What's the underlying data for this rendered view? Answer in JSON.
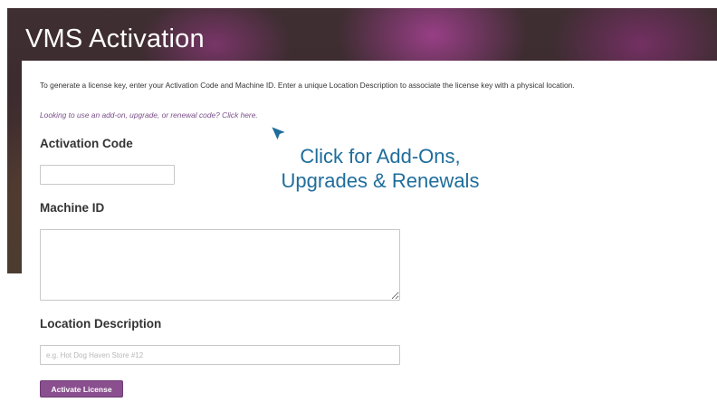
{
  "header": {
    "title": "VMS Activation"
  },
  "form": {
    "intro_text": "To generate a license key, enter your Activation Code and Machine ID. Enter a unique Location Description to associate the license key with a physical location.",
    "addon_link": "Looking to use an add-on, upgrade, or renewal code? Click here.",
    "activation_code": {
      "label": "Activation Code",
      "value": ""
    },
    "machine_id": {
      "label": "Machine ID",
      "value": ""
    },
    "location_description": {
      "label": "Location Description",
      "value": "",
      "placeholder": "e.g. Hot Dog Haven Store #12"
    },
    "activate_button": "Activate License"
  },
  "callout": {
    "line1": "Click for Add-Ons,",
    "line2": "Upgrades & Renewals",
    "icon": "mouse-pointer-icon"
  },
  "colors": {
    "button": "#8a4f8e",
    "link": "#7a4f8a",
    "callout": "#1f6d9c"
  }
}
